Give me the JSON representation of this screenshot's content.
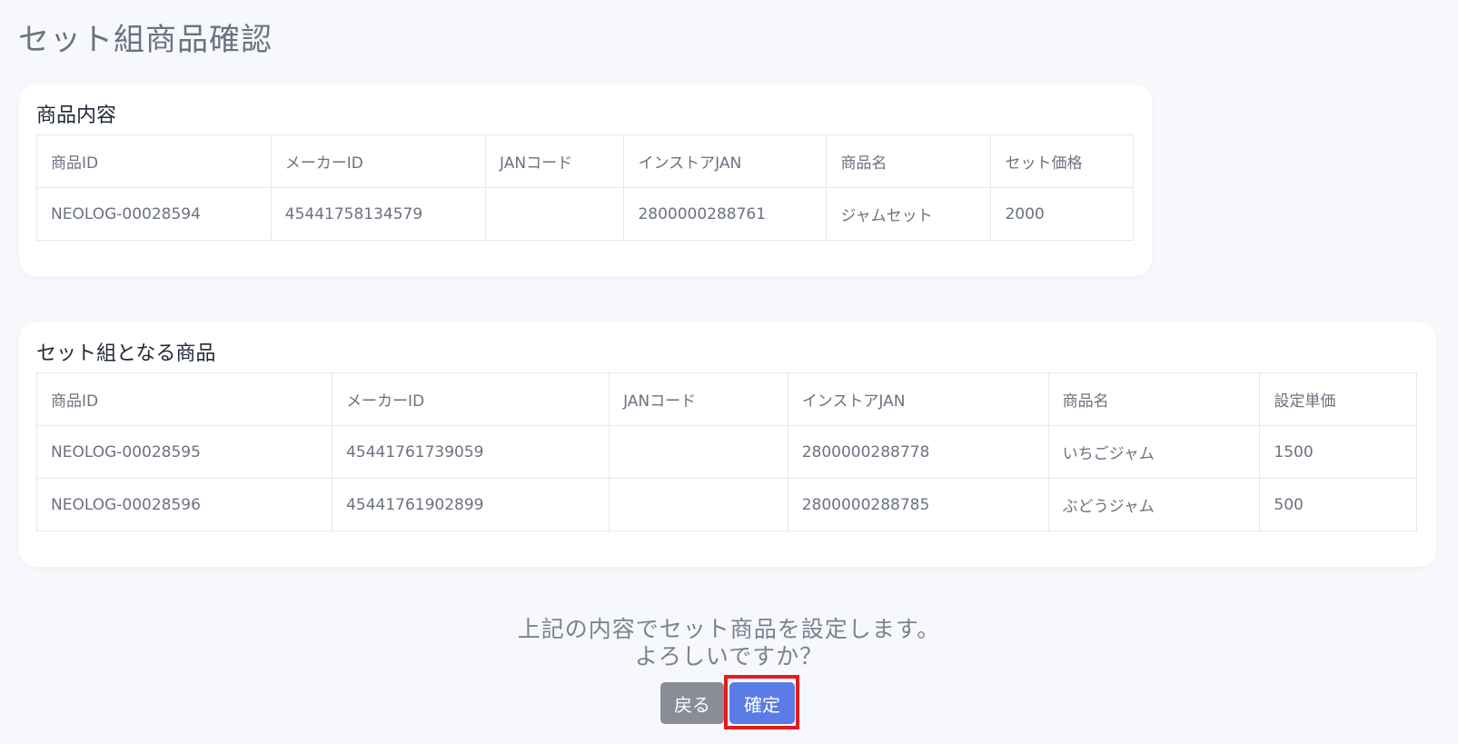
{
  "page_title": "セット組商品確認",
  "product_section": {
    "title": "商品内容",
    "columns": [
      "商品ID",
      "メーカーID",
      "JANコード",
      "インストアJAN",
      "商品名",
      "セット価格"
    ],
    "rows": [
      [
        "NEOLOG-00028594",
        "45441758134579",
        "",
        "2800000288761",
        "ジャムセット",
        "2000"
      ]
    ]
  },
  "set_items_section": {
    "title": "セット組となる商品",
    "columns": [
      "商品ID",
      "メーカーID",
      "JANコード",
      "インストアJAN",
      "商品名",
      "設定単価"
    ],
    "rows": [
      [
        "NEOLOG-00028595",
        "45441761739059",
        "",
        "2800000288778",
        "いちごジャム",
        "1500"
      ],
      [
        "NEOLOG-00028596",
        "45441761902899",
        "",
        "2800000288785",
        "ぶどうジャム",
        "500"
      ]
    ]
  },
  "confirm": {
    "line1": "上記の内容でセット商品を設定します。",
    "line2": "よろしいですか？",
    "back_label": "戻る",
    "confirm_label": "確定"
  },
  "colors": {
    "highlight": "#e11d1d",
    "primary": "#5b7ce6",
    "secondary": "#8a8d96"
  }
}
